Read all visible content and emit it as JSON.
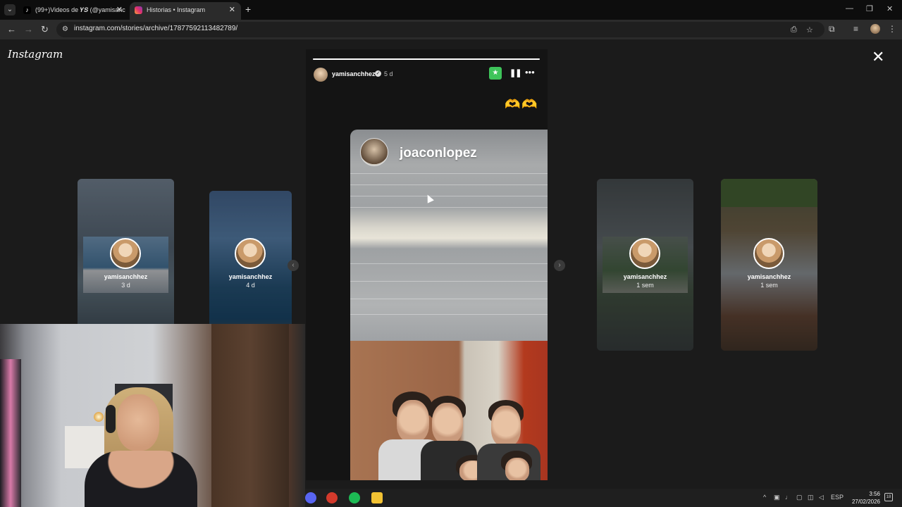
{
  "browser": {
    "tabs": [
      {
        "title": "(99+)Videos de 𝒀𝑺 (@yamisanc",
        "active": false
      },
      {
        "title": "Historias • Instagram",
        "active": true
      }
    ],
    "url": "instagram.com/stories/archive/17877592113482789/",
    "icons": {
      "tab_menu": "chevron-down-icon",
      "new_tab": "plus-icon",
      "close_tab": "close-icon",
      "back": "arrow-left-icon",
      "forward": "arrow-right-icon",
      "reload": "reload-icon",
      "site_info": "tune-icon",
      "install": "install-app-icon",
      "bookmark": "star-icon",
      "extensions": "puzzle-icon",
      "media": "media-control-icon",
      "menu": "kebab-icon"
    }
  },
  "instagram": {
    "logo": "Instagram",
    "close_label": "✕",
    "prev_arrow": "‹",
    "next_arrow": "›",
    "thumbnails": [
      {
        "username": "yamisanchhez",
        "age": "3 d"
      },
      {
        "username": "yamisanchhez",
        "age": "4 d"
      },
      {
        "username": "yamisanchhez",
        "age": "1 sem"
      },
      {
        "username": "yamisanchhez",
        "age": "1 sem"
      }
    ],
    "story": {
      "username": "yamisanchhez",
      "verified_mark": "✓",
      "age": "5 d",
      "progress": 1.0,
      "close_friends_icon": "★",
      "pause_icon": "❚❚",
      "more_icon": "•••",
      "sticker": "🫶🫶",
      "embedded_username": "joaconlopez"
    }
  },
  "taskbar": {
    "tray_lang": "ESP",
    "time": "3:56",
    "date": "27/02/2026",
    "notifications": "18",
    "apps": [
      {
        "name": "discord-icon",
        "color": "#5865f2"
      },
      {
        "name": "chrome-icon",
        "color": "#d33a2c"
      },
      {
        "name": "spotify-icon",
        "color": "#1db954"
      },
      {
        "name": "file-explorer-icon",
        "color": "#f2c233"
      }
    ]
  }
}
